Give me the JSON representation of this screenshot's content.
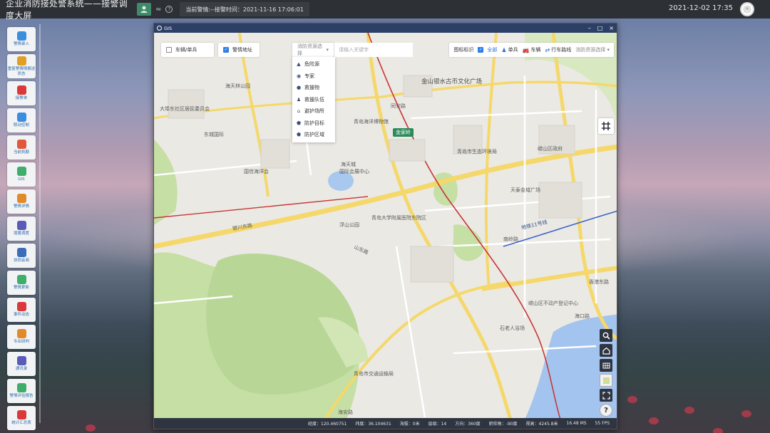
{
  "topbar": {
    "app_title": "企业消防接处警系统——接警调度大屏",
    "mini_icon_text": "≈",
    "help_icon_text": "?",
    "alarm_prefix": "当前警情:--接警时间：",
    "alarm_time": "2021-11-16 17:06:01",
    "datetime": "2021-12-02 17:35"
  },
  "sidebar": {
    "items": [
      {
        "label": "警情录入",
        "color": "#3b8de0"
      },
      {
        "label": "重复警情情报送状态",
        "color": "#e0a028"
      },
      {
        "label": "接警单",
        "color": "#d9393a"
      },
      {
        "label": "联动控制",
        "color": "#3b8de0"
      },
      {
        "label": "当前执勤",
        "color": "#e05a3a"
      },
      {
        "label": "GIS",
        "color": "#3fae6a"
      },
      {
        "label": "警情详情",
        "color": "#e08a2a"
      },
      {
        "label": "增援调度",
        "color": "#5a5ab8"
      },
      {
        "label": "协同会商",
        "color": "#3b6db8"
      },
      {
        "label": "警情更新",
        "color": "#3fae6a"
      },
      {
        "label": "事件动态",
        "color": "#d9393a"
      },
      {
        "label": "专业研判",
        "color": "#e08a2a"
      },
      {
        "label": "通讯录",
        "color": "#5a5ab8"
      },
      {
        "label": "警情评估报告",
        "color": "#3fae6a"
      },
      {
        "label": "统计汇总表",
        "color": "#d9393a"
      }
    ]
  },
  "gis": {
    "title": "GIS",
    "win_min": "–",
    "win_max": "□",
    "win_close": "×",
    "filters": {
      "vehicle_label": "车辆/单兵",
      "address_label": "警情地址",
      "resource_label": "消防资源选择",
      "resource_arrow": "▾",
      "search_placeholder": "请输入关键字"
    },
    "resource_menu": [
      {
        "label": "危险源",
        "icon": "warning-icon",
        "glyph": "▲"
      },
      {
        "label": "专家",
        "icon": "expert-icon",
        "glyph": "◉"
      },
      {
        "label": "救援物",
        "icon": "supply-icon",
        "glyph": "●"
      },
      {
        "label": "救援队伍",
        "icon": "team-icon",
        "glyph": "♟"
      },
      {
        "label": "避护场所",
        "icon": "shelter-icon",
        "glyph": "⌂"
      },
      {
        "label": "防护目标",
        "icon": "shield-icon",
        "glyph": "⬟"
      },
      {
        "label": "防护区域",
        "icon": "area-shield-icon",
        "glyph": "⬟"
      }
    ],
    "legend": {
      "title": "图标标识",
      "all": "全部",
      "single": "单兵",
      "vehicle": "车辆",
      "route": "行车路线",
      "resource": "消防资源选择",
      "resource_arrow": "▾"
    },
    "status": {
      "longitude": "经度：120.460751",
      "latitude": "纬度：36.104631",
      "altitude": "海拔：0米",
      "level": "层级：14",
      "heading": "方向：360度",
      "pitch": "俯仰角：-90度",
      "view_height": "视高：4245.8米",
      "ms": "16.48 MS",
      "fps": "55 FPS"
    },
    "map_labels": {
      "l1": "金山银水古币文化广场",
      "l2": "大埠东社区居民委员会",
      "l3": "青岛海洋博物馆",
      "l4": "海天林公园",
      "l5": "国信海洋会",
      "l6": "海天城",
      "l7": "东城国际",
      "l8": "青岛大学附属医院东院区",
      "l9": "崂山区政府",
      "l10": "金家岭",
      "l11": "南岭路",
      "l12": "银川东路",
      "l13": "香港东路",
      "l14": "海口路",
      "l15": "海安路",
      "l16": "石老人浴场",
      "l17": "青岛市交通运输局",
      "l18": "浮山公园",
      "l19": "国际会展中心",
      "l20": "山东路",
      "l21": "天泰金域广场",
      "l22": "同安路",
      "l23": "地铁11号线",
      "l24": "青岛市生态环境局",
      "l25": "崂山区不动产登记中心"
    }
  }
}
